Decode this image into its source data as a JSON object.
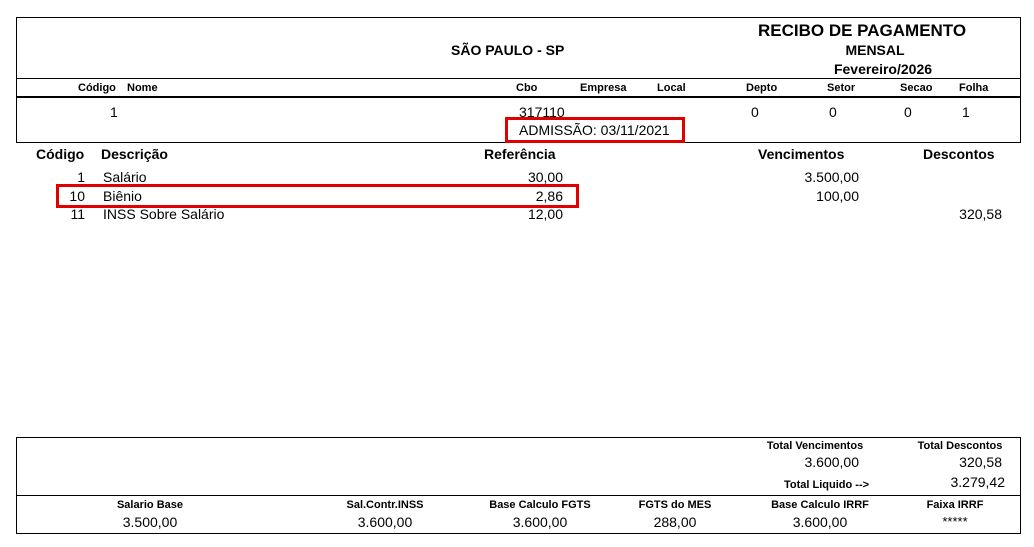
{
  "header": {
    "city": "SÃO PAULO - SP",
    "title": "RECIBO DE PAGAMENTO",
    "period_type": "MENSAL",
    "month": "Fevereiro/2026"
  },
  "employee_header": {
    "labels": {
      "codigo": "Código",
      "nome": "Nome",
      "cbo": "Cbo",
      "empresa": "Empresa",
      "local": "Local",
      "depto": "Depto",
      "setor": "Setor",
      "secao": "Secao",
      "folha": "Folha"
    },
    "values": {
      "codigo": "1",
      "cbo": "317110",
      "depto": "0",
      "setor": "0",
      "secao": "0",
      "folha": "1",
      "admissao": "ADMISSÃO: 03/11/2021"
    }
  },
  "items": {
    "headers": {
      "codigo": "Código",
      "descricao": "Descrição",
      "referencia": "Referência",
      "vencimentos": "Vencimentos",
      "descontos": "Descontos"
    },
    "rows": [
      {
        "codigo": "1",
        "descricao": "Salário",
        "referencia": "30,00",
        "vencimento": "3.500,00",
        "desconto": ""
      },
      {
        "codigo": "10",
        "descricao": "Biênio",
        "referencia": "2,86",
        "vencimento": "100,00",
        "desconto": ""
      },
      {
        "codigo": "11",
        "descricao": "INSS Sobre Salário",
        "referencia": "12,00",
        "vencimento": "",
        "desconto": "320,58"
      }
    ]
  },
  "totals": {
    "total_vencimentos_label": "Total Vencimentos",
    "total_vencimentos": "3.600,00",
    "total_descontos_label": "Total Descontos",
    "total_descontos": "320,58",
    "total_liquido_label": "Total Liquido -->",
    "total_liquido": "3.279,42"
  },
  "bases": [
    {
      "label": "Salario Base",
      "value": "3.500,00"
    },
    {
      "label": "Sal.Contr.INSS",
      "value": "3.600,00"
    },
    {
      "label": "Base Calculo FGTS",
      "value": "3.600,00"
    },
    {
      "label": "FGTS do MES",
      "value": "288,00"
    },
    {
      "label": "Base Calculo IRRF",
      "value": "3.600,00"
    },
    {
      "label": "Faixa IRRF",
      "value": "*****"
    }
  ],
  "highlight_color": "#e00000"
}
